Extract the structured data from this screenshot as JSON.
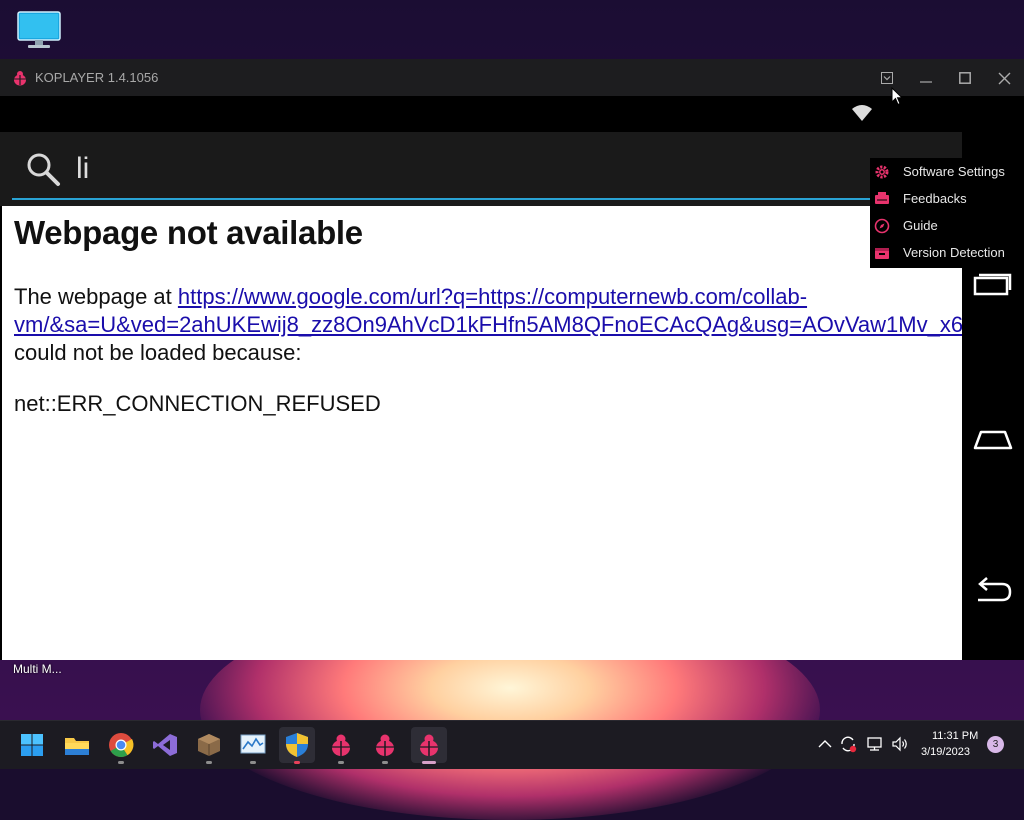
{
  "desktop": {
    "icon": "monitor-icon",
    "taskbar_label": "Multi M..."
  },
  "window": {
    "title": "KOPLAYER 1.4.1056",
    "controls": [
      "menu-icon",
      "minimize-icon",
      "maximize-icon",
      "close-icon"
    ]
  },
  "search": {
    "value": "li"
  },
  "error_page": {
    "title": "Webpage not available",
    "prefix": "The webpage at ",
    "url_line1": "https://www.google.com/url?q=https://computernewb.com/collab-",
    "url_line2": "vm/&sa=U&ved=2ahUKEwij8_zz8On9AhVcD1kFHfn5AM8QFnoECAcQAg&usg=AOvVaw1Mv_x6",
    "suffix": "could not be loaded because:",
    "code": "net::ERR_CONNECTION_REFUSED"
  },
  "menu": {
    "items": [
      {
        "label": "Software Settings",
        "icon": "gear-icon"
      },
      {
        "label": "Feedbacks",
        "icon": "feedback-icon"
      },
      {
        "label": "Guide",
        "icon": "compass-icon"
      },
      {
        "label": "Version Detection",
        "icon": "update-icon"
      }
    ]
  },
  "taskbar": {
    "apps": [
      "windows-start-icon",
      "file-explorer-icon",
      "chrome-icon",
      "visual-studio-icon",
      "minecraft-icon",
      "resource-monitor-icon",
      "windows-security-icon",
      "koplayer-icon",
      "koplayer-icon",
      "koplayer-icon"
    ],
    "time": "11:31 PM",
    "date": "3/19/2023",
    "notifications": "3"
  },
  "colors": {
    "accent": "#e8336d",
    "link": "#1a0dab",
    "search_underline": "#29a3d4"
  }
}
